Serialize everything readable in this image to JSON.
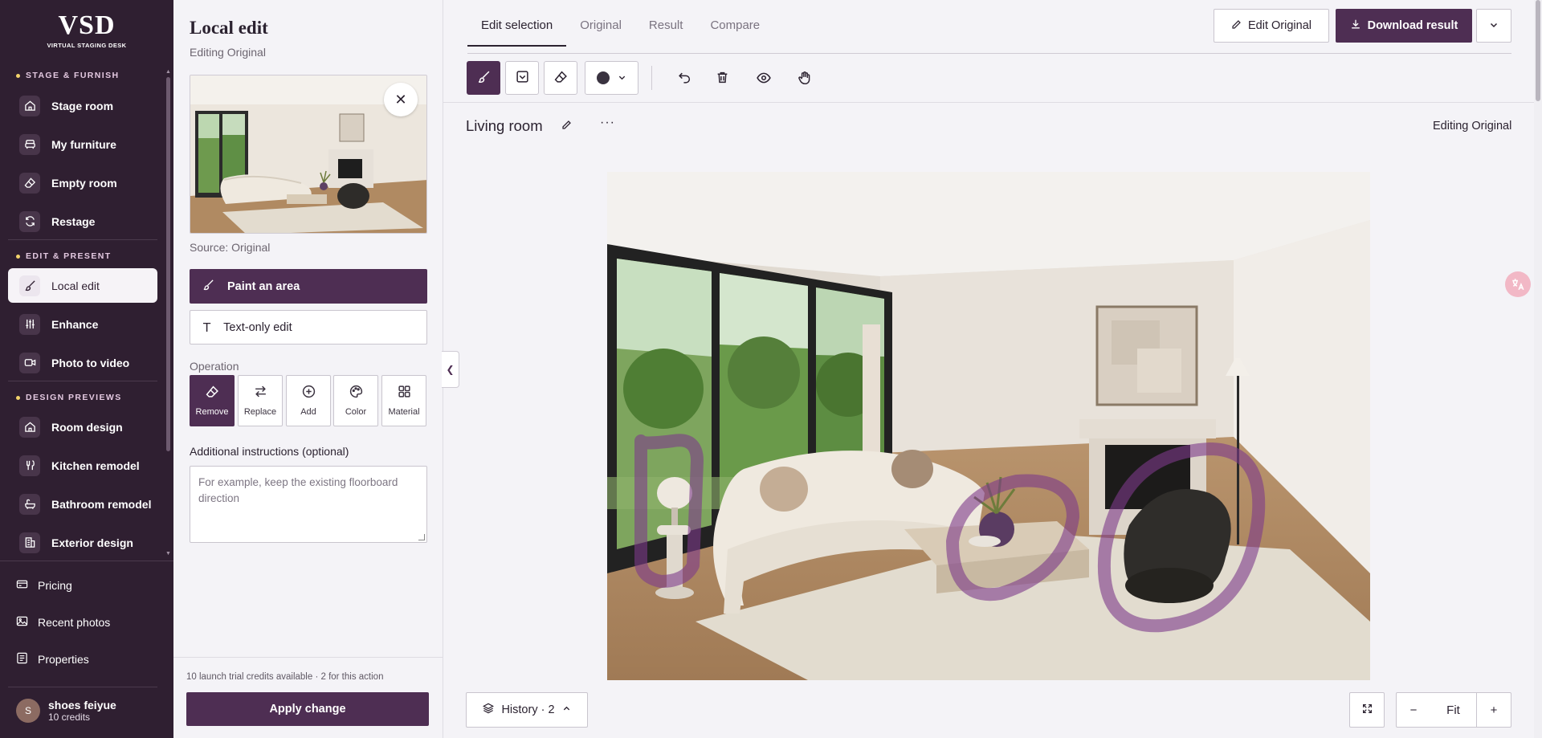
{
  "brand": {
    "name": "VSD",
    "tagline": "VIRTUAL STAGING DESK"
  },
  "sidebar": {
    "sections": [
      {
        "label": "STAGE & FURNISH"
      },
      {
        "label": "EDIT & PRESENT"
      },
      {
        "label": "DESIGN PREVIEWS"
      }
    ],
    "items": [
      {
        "label": "Stage room",
        "icon": "home-icon"
      },
      {
        "label": "My furniture",
        "icon": "sofa-icon"
      },
      {
        "label": "Empty room",
        "icon": "eraser-icon"
      },
      {
        "label": "Restage",
        "icon": "refresh-icon"
      },
      {
        "label": "Local edit",
        "icon": "brush-icon",
        "active": true
      },
      {
        "label": "Enhance",
        "icon": "sliders-icon"
      },
      {
        "label": "Photo to video",
        "icon": "video-icon"
      },
      {
        "label": "Room design",
        "icon": "home-icon"
      },
      {
        "label": "Kitchen remodel",
        "icon": "utensils-icon"
      },
      {
        "label": "Bathroom remodel",
        "icon": "bath-icon"
      },
      {
        "label": "Exterior design",
        "icon": "building-icon"
      }
    ],
    "bottom": [
      {
        "label": "Pricing",
        "icon": "card-icon"
      },
      {
        "label": "Recent photos",
        "icon": "image-icon"
      },
      {
        "label": "Properties",
        "icon": "list-icon"
      }
    ],
    "user": {
      "initial": "S",
      "name": "shoes feiyue",
      "credits": "10 credits"
    }
  },
  "panel": {
    "title": "Local edit",
    "subtitle": "Editing Original",
    "source": "Source: Original",
    "modes": {
      "paint": "Paint an area",
      "text": "Text-only edit"
    },
    "operation_label": "Operation",
    "operations": [
      "Remove",
      "Replace",
      "Add",
      "Color",
      "Material"
    ],
    "active_operation": "Remove",
    "instructions_label": "Additional instructions (optional)",
    "instructions_placeholder": "For example, keep the existing floorboard direction",
    "credits_note": "10 launch trial credits available · 2 for this action",
    "apply_label": "Apply change"
  },
  "main": {
    "tabs": [
      "Edit selection",
      "Original",
      "Result",
      "Compare"
    ],
    "active_tab": "Edit selection",
    "edit_original_label": "Edit Original",
    "download_label": "Download result",
    "room_title": "Living room",
    "editing_label": "Editing Original",
    "history_label": "History · 2",
    "zoom_label": "Fit"
  },
  "colors": {
    "brand": "#4e2e53",
    "sidebar": "#2f1f31",
    "accent_dot": "#f3d36b",
    "mask": "#7d3a8a"
  }
}
